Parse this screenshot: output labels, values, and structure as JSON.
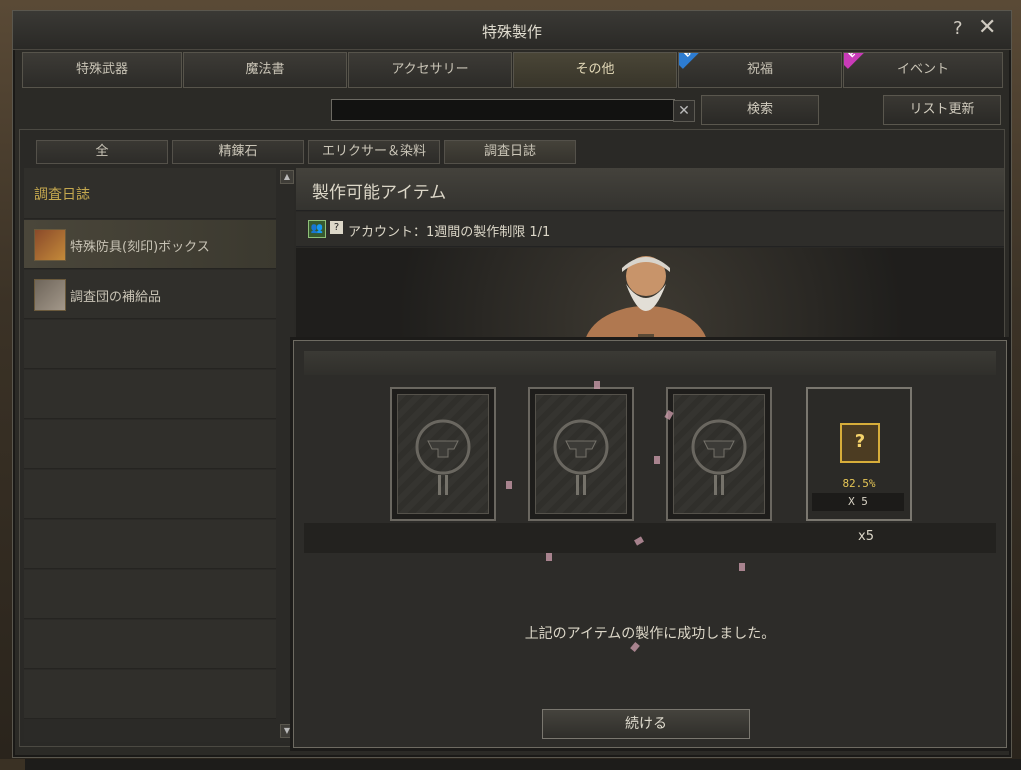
{
  "window": {
    "title": "特殊製作",
    "help": "?",
    "close": "✕"
  },
  "tabs": [
    {
      "label": "特殊武器"
    },
    {
      "label": "魔法書"
    },
    {
      "label": "アクセサリー"
    },
    {
      "label": "その他"
    },
    {
      "label": "祝福",
      "badge": "BLESS"
    },
    {
      "label": "イベント",
      "badge": "EVENT"
    }
  ],
  "search": {
    "value": "",
    "clear": "✕",
    "button": "検索",
    "refresh": "リスト更新"
  },
  "subtabs": [
    "全",
    "精錬石",
    "エリクサー＆染料",
    "調査日誌"
  ],
  "sidebar": {
    "header": "調査日誌",
    "items": [
      {
        "label": "特殊防具(刻印)ボックス"
      },
      {
        "label": "調査団の補給品"
      }
    ],
    "scroll_up": "▲",
    "scroll_down": "▼"
  },
  "panel": {
    "title": "製作可能アイテム",
    "account_icon": "👥",
    "help_icon": "?",
    "account_text": "アカウント：1週間の製作制限 1/1"
  },
  "dialog": {
    "result_icon": "?",
    "percent": "82.5%",
    "count": "X 5",
    "multiplier": "x5",
    "message": "上記のアイテムの製作に成功しました。",
    "continue": "続ける"
  },
  "colors": {
    "accent": "#c6a94f",
    "bless": "#2d7cd1",
    "event": "#c93bb8"
  }
}
